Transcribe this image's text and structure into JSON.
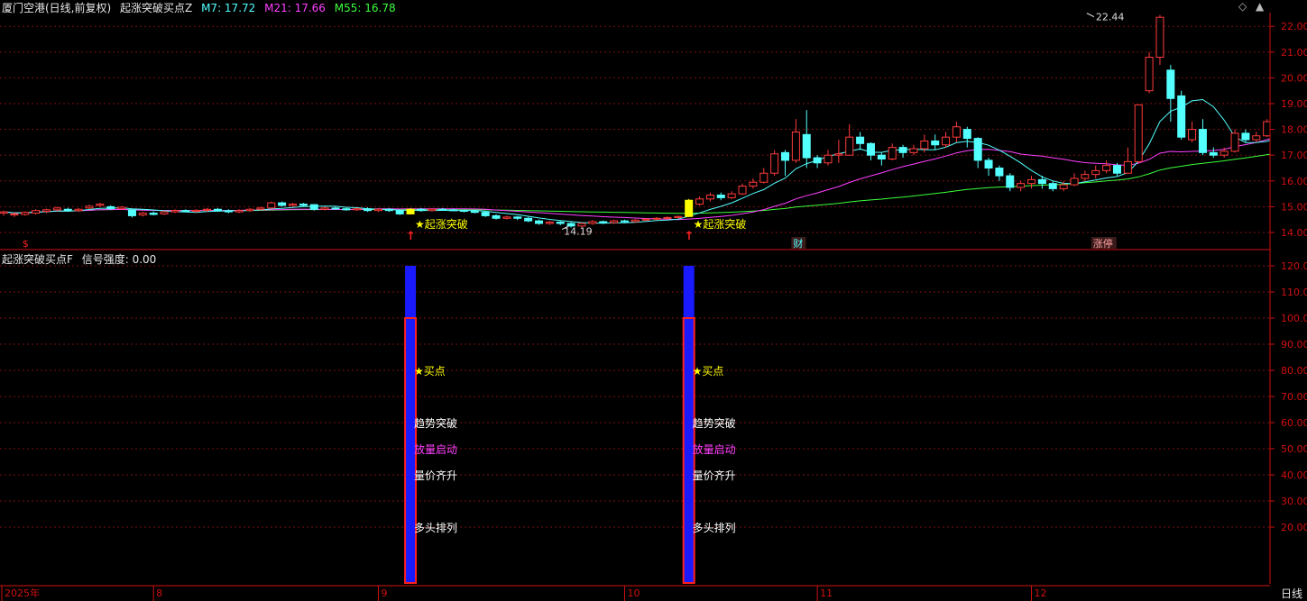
{
  "header": {
    "stock": "厦门空港(日线,前复权)",
    "indicator": "起涨突破买点Z",
    "ma7_label": "M7: 17.72",
    "ma21_label": "M21: 17.66",
    "ma55_label": "M55: 16.78"
  },
  "sub_header": {
    "indicator": "起涨突破买点F",
    "strength_label": "信号强度: 0.00"
  },
  "controls": {
    "diamond": "◇",
    "up": "▲"
  },
  "period_label": "日线",
  "colors": {
    "up": "#ff3b3b",
    "down": "#54ffff",
    "ma7": "#54ffff",
    "ma21": "#ff40ff",
    "ma55": "#3cff3c",
    "axis": "#d01010",
    "grid": "#7a1010",
    "star": "#ffff00",
    "blue_bar": "#1a1aff"
  },
  "chart_data": [
    {
      "type": "candlestick",
      "title": "厦门空港(日线,前复权)",
      "ylim": [
        13.6,
        22.8
      ],
      "y_ticks": [
        "14.00",
        "15.00",
        "16.00",
        "17.00",
        "18.00",
        "19.00",
        "20.00",
        "21.00",
        "22.00"
      ],
      "annotations": {
        "high": {
          "label": "22.44",
          "value": 22.44,
          "index": 101
        },
        "low": {
          "label": "14.19",
          "value": 14.19,
          "index": 53
        }
      },
      "signals": [
        {
          "index": 38,
          "label": "★起涨突破",
          "arrow": "↑"
        },
        {
          "index": 64,
          "label": "★起涨突破",
          "arrow": "↑"
        }
      ],
      "markers": [
        {
          "index": 2,
          "label": "$"
        },
        {
          "index": 74,
          "label": "财"
        },
        {
          "index": 102,
          "label": "涨停"
        }
      ],
      "x_labels": [
        {
          "label": "2025年",
          "index": 0
        },
        {
          "label": "8",
          "index": 14
        },
        {
          "label": "9",
          "index": 35
        },
        {
          "label": "10",
          "index": 58
        },
        {
          "label": "11",
          "index": 76
        },
        {
          "label": "12",
          "index": 96
        }
      ],
      "candles": [
        [
          14.75,
          14.8,
          14.65,
          14.85
        ],
        [
          14.68,
          14.72,
          14.6,
          14.78
        ],
        [
          14.7,
          14.78,
          14.65,
          14.82
        ],
        [
          14.75,
          14.85,
          14.7,
          14.9
        ],
        [
          14.82,
          14.88,
          14.75,
          14.92
        ],
        [
          14.88,
          14.95,
          14.82,
          15.0
        ],
        [
          14.9,
          14.85,
          14.8,
          14.96
        ],
        [
          14.85,
          14.9,
          14.8,
          14.95
        ],
        [
          14.95,
          15.02,
          14.9,
          15.08
        ],
        [
          15.05,
          15.1,
          15.0,
          15.15
        ],
        [
          15.0,
          14.92,
          14.88,
          15.05
        ],
        [
          14.92,
          14.98,
          14.87,
          15.02
        ],
        [
          14.88,
          14.65,
          14.58,
          14.92
        ],
        [
          14.68,
          14.75,
          14.62,
          14.8
        ],
        [
          14.75,
          14.7,
          14.66,
          14.82
        ],
        [
          14.72,
          14.8,
          14.68,
          14.85
        ],
        [
          14.8,
          14.85,
          14.75,
          14.9
        ],
        [
          14.85,
          14.82,
          14.78,
          14.9
        ],
        [
          14.82,
          14.86,
          14.76,
          14.9
        ],
        [
          14.86,
          14.9,
          14.8,
          14.95
        ],
        [
          14.9,
          14.85,
          14.8,
          14.95
        ],
        [
          14.85,
          14.8,
          14.75,
          14.9
        ],
        [
          14.8,
          14.85,
          14.75,
          14.9
        ],
        [
          14.85,
          14.9,
          14.8,
          14.95
        ],
        [
          14.9,
          14.95,
          14.85,
          15.0
        ],
        [
          14.95,
          15.15,
          14.9,
          15.2
        ],
        [
          15.15,
          15.05,
          15.0,
          15.2
        ],
        [
          15.05,
          15.1,
          15.0,
          15.15
        ],
        [
          15.1,
          15.05,
          15.0,
          15.15
        ],
        [
          15.08,
          14.9,
          14.85,
          15.1
        ],
        [
          14.9,
          14.95,
          14.85,
          15.0
        ],
        [
          14.95,
          14.92,
          14.88,
          15.0
        ],
        [
          14.92,
          14.88,
          14.84,
          14.96
        ],
        [
          14.88,
          14.92,
          14.84,
          14.96
        ],
        [
          14.92,
          14.85,
          14.8,
          14.98
        ],
        [
          14.85,
          14.9,
          14.8,
          14.95
        ],
        [
          14.9,
          14.85,
          14.8,
          14.95
        ],
        [
          14.85,
          14.72,
          14.68,
          14.88
        ],
        [
          14.72,
          14.9,
          14.7,
          14.95
        ],
        [
          14.9,
          14.85,
          14.8,
          14.95
        ],
        [
          14.85,
          14.9,
          14.82,
          14.95
        ],
        [
          14.9,
          14.88,
          14.84,
          14.95
        ],
        [
          14.88,
          14.86,
          14.82,
          14.92
        ],
        [
          14.86,
          14.82,
          14.78,
          14.9
        ],
        [
          14.82,
          14.78,
          14.74,
          14.86
        ],
        [
          14.78,
          14.65,
          14.6,
          14.82
        ],
        [
          14.65,
          14.55,
          14.5,
          14.7
        ],
        [
          14.55,
          14.6,
          14.5,
          14.65
        ],
        [
          14.6,
          14.55,
          14.48,
          14.64
        ],
        [
          14.55,
          14.45,
          14.4,
          14.6
        ],
        [
          14.45,
          14.35,
          14.3,
          14.5
        ],
        [
          14.35,
          14.4,
          14.3,
          14.45
        ],
        [
          14.4,
          14.35,
          14.28,
          14.45
        ],
        [
          14.35,
          14.25,
          14.19,
          14.4
        ],
        [
          14.25,
          14.35,
          14.2,
          14.4
        ],
        [
          14.35,
          14.42,
          14.3,
          14.48
        ],
        [
          14.42,
          14.38,
          14.33,
          14.46
        ],
        [
          14.38,
          14.45,
          14.33,
          14.5
        ],
        [
          14.45,
          14.42,
          14.36,
          14.5
        ],
        [
          14.42,
          14.48,
          14.38,
          14.52
        ],
        [
          14.48,
          14.52,
          14.44,
          14.56
        ],
        [
          14.52,
          14.55,
          14.48,
          14.6
        ],
        [
          14.55,
          14.58,
          14.5,
          14.62
        ],
        [
          14.58,
          14.62,
          14.54,
          14.66
        ],
        [
          14.62,
          15.25,
          14.6,
          15.3
        ],
        [
          15.1,
          15.3,
          15.05,
          15.4
        ],
        [
          15.3,
          15.45,
          15.2,
          15.55
        ],
        [
          15.45,
          15.35,
          15.25,
          15.55
        ],
        [
          15.35,
          15.5,
          15.3,
          15.6
        ],
        [
          15.5,
          15.8,
          15.45,
          15.9
        ],
        [
          15.8,
          15.95,
          15.7,
          16.1
        ],
        [
          15.95,
          16.3,
          15.9,
          16.5
        ],
        [
          16.3,
          17.05,
          16.2,
          17.2
        ],
        [
          17.1,
          16.8,
          16.2,
          17.2
        ],
        [
          16.8,
          17.9,
          16.7,
          18.4
        ],
        [
          17.8,
          16.9,
          16.5,
          18.75
        ],
        [
          16.9,
          16.7,
          16.5,
          17.0
        ],
        [
          16.7,
          17.0,
          16.6,
          17.2
        ],
        [
          17.0,
          17.05,
          16.7,
          17.6
        ],
        [
          17.0,
          17.7,
          17.0,
          18.2
        ],
        [
          17.7,
          17.45,
          17.2,
          17.9
        ],
        [
          17.45,
          17.0,
          16.8,
          17.5
        ],
        [
          17.0,
          16.85,
          16.6,
          17.1
        ],
        [
          16.85,
          17.3,
          16.8,
          17.45
        ],
        [
          17.3,
          17.1,
          16.9,
          17.4
        ],
        [
          17.1,
          17.25,
          17.0,
          17.4
        ],
        [
          17.25,
          17.55,
          17.1,
          17.8
        ],
        [
          17.55,
          17.4,
          17.2,
          17.8
        ],
        [
          17.4,
          17.7,
          17.3,
          17.9
        ],
        [
          17.7,
          18.1,
          17.5,
          18.3
        ],
        [
          18.0,
          17.65,
          17.3,
          18.1
        ],
        [
          17.65,
          16.8,
          16.5,
          17.7
        ],
        [
          16.8,
          16.5,
          16.2,
          16.9
        ],
        [
          16.5,
          16.2,
          16.0,
          16.6
        ],
        [
          16.2,
          15.75,
          15.6,
          16.3
        ],
        [
          15.75,
          15.9,
          15.6,
          16.0
        ],
        [
          15.9,
          16.05,
          15.7,
          16.2
        ],
        [
          16.05,
          15.9,
          15.7,
          16.2
        ],
        [
          15.9,
          15.7,
          15.6,
          16.0
        ],
        [
          15.7,
          15.85,
          15.6,
          16.0
        ],
        [
          15.85,
          16.1,
          15.8,
          16.3
        ],
        [
          16.1,
          16.25,
          16.0,
          16.4
        ],
        [
          16.25,
          16.4,
          16.1,
          16.6
        ],
        [
          16.4,
          16.6,
          16.3,
          16.8
        ],
        [
          16.6,
          16.3,
          16.2,
          16.7
        ],
        [
          16.3,
          16.75,
          16.3,
          17.3
        ],
        [
          16.75,
          18.95,
          16.7,
          18.95
        ],
        [
          19.5,
          20.8,
          19.4,
          21.0
        ],
        [
          20.8,
          22.35,
          20.5,
          22.44
        ],
        [
          20.3,
          19.2,
          18.3,
          20.5
        ],
        [
          19.3,
          17.7,
          17.6,
          19.5
        ],
        [
          17.6,
          18.0,
          17.5,
          18.3
        ],
        [
          18.0,
          17.1,
          17.0,
          18.4
        ],
        [
          17.1,
          17.0,
          16.9,
          17.3
        ],
        [
          17.0,
          17.15,
          16.9,
          17.3
        ],
        [
          17.15,
          17.85,
          17.1,
          18.0
        ],
        [
          17.85,
          17.6,
          17.5,
          18.0
        ],
        [
          17.6,
          17.75,
          17.5,
          17.9
        ],
        [
          17.75,
          18.3,
          17.7,
          18.4
        ],
        [
          18.3,
          18.1,
          18.0,
          18.7
        ],
        [
          18.1,
          18.05,
          18.0,
          18.2
        ]
      ],
      "ma7_last": 17.72,
      "ma21_last": 17.66,
      "ma55_last": 16.78
    },
    {
      "type": "bar",
      "title": "起涨突破买点F",
      "ylim": [
        0,
        125
      ],
      "y_ticks": [
        "20.00",
        "30.00",
        "40.00",
        "50.00",
        "60.00",
        "70.00",
        "80.00",
        "90.00",
        "100.00",
        "110.00",
        "120.00"
      ],
      "signals": [
        {
          "index": 38,
          "outer_value": 100,
          "inner_value": 120,
          "labels": [
            {
              "text": "★买点",
              "value": 80,
              "color": "#ffff00"
            },
            {
              "text": "趋势突破",
              "value": 60,
              "color": "#ffffff"
            },
            {
              "text": "放量启动",
              "value": 50,
              "color": "#ff40ff"
            },
            {
              "text": "量价齐升",
              "value": 40,
              "color": "#ffffff"
            },
            {
              "text": "多头排列",
              "value": 20,
              "color": "#ffffff"
            }
          ]
        },
        {
          "index": 64,
          "outer_value": 100,
          "inner_value": 120,
          "labels": [
            {
              "text": "★买点",
              "value": 80,
              "color": "#ffff00"
            },
            {
              "text": "趋势突破",
              "value": 60,
              "color": "#ffffff"
            },
            {
              "text": "放量启动",
              "value": 50,
              "color": "#ff40ff"
            },
            {
              "text": "量价齐升",
              "value": 40,
              "color": "#ffffff"
            },
            {
              "text": "多头排列",
              "value": 20,
              "color": "#ffffff"
            }
          ]
        }
      ]
    }
  ]
}
